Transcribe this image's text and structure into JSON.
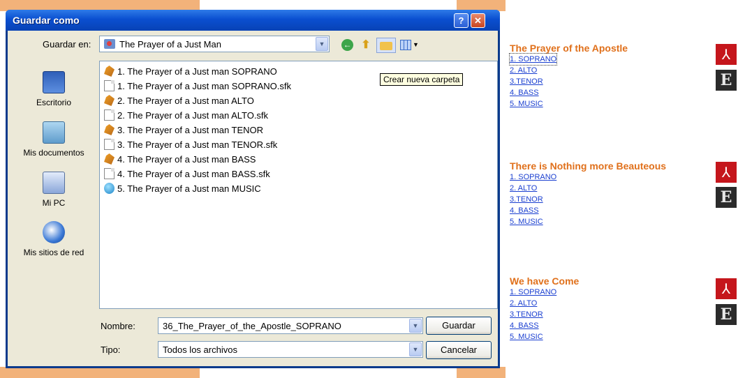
{
  "dialog": {
    "title": "Guardar como",
    "help_glyph": "?",
    "close_glyph": "✕",
    "lookin_label": "Guardar en:",
    "lookin_value": "The Prayer of a Just Man",
    "tooltip": "Crear nueva carpeta",
    "places": [
      {
        "label": "Escritorio",
        "icon": "desktop-icon"
      },
      {
        "label": "Mis documentos",
        "icon": "my-documents-icon"
      },
      {
        "label": "Mi PC",
        "icon": "my-computer-icon"
      },
      {
        "label": "Mis sitios de red",
        "icon": "network-places-icon"
      }
    ],
    "files": [
      {
        "name": "1. The Prayer of a Just man SOPRANO",
        "icon": "encore-file-icon"
      },
      {
        "name": "1. The Prayer of a Just man SOPRANO.sfk",
        "icon": "document-icon"
      },
      {
        "name": "2. The Prayer of a Just man ALTO",
        "icon": "encore-file-icon"
      },
      {
        "name": "2. The Prayer of a Just man ALTO.sfk",
        "icon": "document-icon"
      },
      {
        "name": "3. The Prayer of a Just man TENOR",
        "icon": "encore-file-icon"
      },
      {
        "name": "3. The Prayer of a Just man TENOR.sfk",
        "icon": "document-icon"
      },
      {
        "name": "4. The Prayer of a Just man BASS",
        "icon": "encore-file-icon"
      },
      {
        "name": "4. The Prayer of a Just man BASS.sfk",
        "icon": "document-icon"
      },
      {
        "name": "5. The Prayer of a Just man MUSIC",
        "icon": "music-file-icon"
      }
    ],
    "name_label": "Nombre:",
    "name_value": "36_The_Prayer_of_the_Apostle_SOPRANO",
    "type_label": "Tipo:",
    "type_value": "Todos los archivos",
    "save_label": "Guardar",
    "cancel_label": "Cancelar"
  },
  "page": {
    "songs": [
      {
        "title": "The Prayer of the Apostle",
        "links": [
          "1. SOPRANO",
          "2. ALTO",
          "3.TENOR",
          "4. BASS",
          "5. MUSIC"
        ]
      },
      {
        "title": "There is Nothing more Beauteous",
        "links": [
          "1. SOPRANO",
          "2. ALTO",
          "3.TENOR",
          "4. BASS",
          "5. MUSIC"
        ]
      },
      {
        "title": "We have Come",
        "links": [
          "1. SOPRANO",
          "2. ALTO",
          "3.TENOR",
          "4. BASS",
          "5. MUSIC"
        ]
      }
    ],
    "pdf_glyph": "⅄",
    "encore_glyph": "E"
  },
  "colors": {
    "title_orange": "#e0701b",
    "link_blue": "#1a3fd0",
    "xp_blue": "#0a4fd0",
    "dialog_bg": "#ece9d8"
  }
}
